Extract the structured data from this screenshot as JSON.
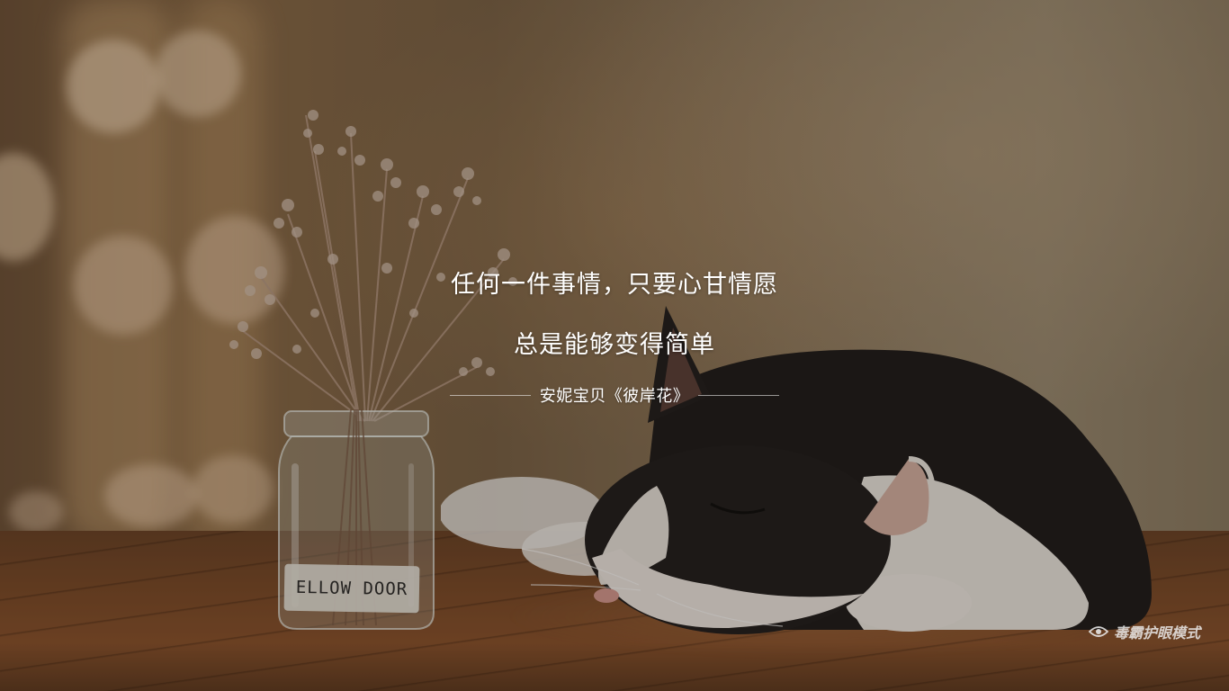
{
  "quote": {
    "line1": "任何一件事情，只要心甘情愿",
    "line2": "总是能够变得简单",
    "attribution": "安妮宝贝《彼岸花》"
  },
  "jar": {
    "label": "ELLOW DOOR"
  },
  "watermark": {
    "icon": "eye-icon",
    "text": "毒霸护眼模式"
  },
  "colors": {
    "text": "#ffffff",
    "watermark": "#f0f0f0"
  }
}
